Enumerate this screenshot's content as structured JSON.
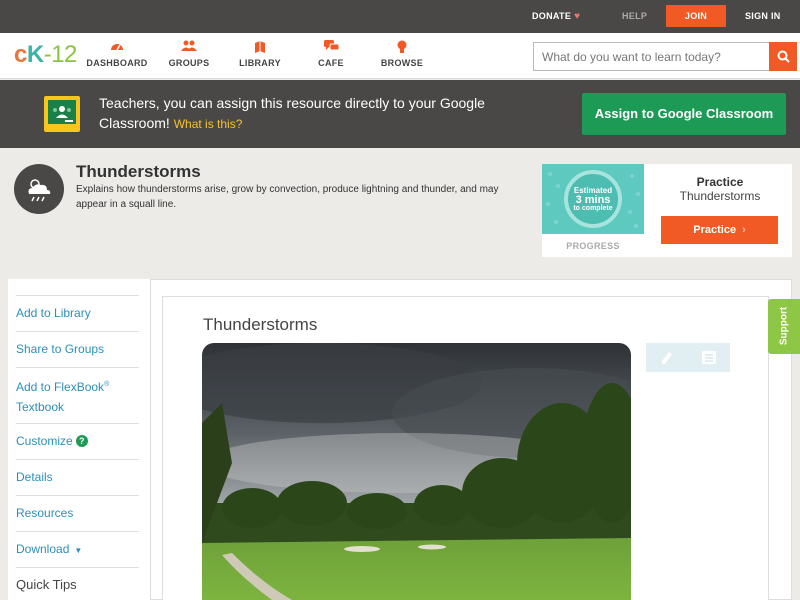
{
  "util": {
    "donate": "DONATE",
    "help": "HELP",
    "join": "JOIN",
    "signin": "SIGN IN"
  },
  "brand": {
    "logo_c": "c",
    "logo_k": "K",
    "logo_dash": "-",
    "logo_num": "12"
  },
  "nav": {
    "dashboard": "DASHBOARD",
    "groups": "GROUPS",
    "library": "LIBRARY",
    "cafe": "CAFE",
    "browse": "BROWSE"
  },
  "search": {
    "placeholder": "What do you want to learn today?"
  },
  "banner": {
    "text": "Teachers, you can assign this resource directly to your Google Classroom!",
    "whatis": "What is this?",
    "button": "Assign to Google Classroom"
  },
  "concept": {
    "title": "Thunderstorms",
    "description": "Explains how thunderstorms arise, grow by convection, produce lightning and thunder, and may appear in a squall line."
  },
  "practice_card": {
    "estimated": "Estimated",
    "mins": "3 mins",
    "to_complete": "to complete",
    "progress_label": "PROGRESS",
    "title": "Practice",
    "subtitle": "Thunderstorms",
    "button": "Practice"
  },
  "sidebar": {
    "items": [
      {
        "label": "Add to Library"
      },
      {
        "label": "Share to Groups"
      },
      {
        "label": "Add to FlexBook",
        "sup": "®",
        "label2": "Textbook"
      },
      {
        "label": "Customize"
      },
      {
        "label": "Details"
      },
      {
        "label": "Resources"
      },
      {
        "label": "Download"
      },
      {
        "label": "Quick Tips"
      }
    ]
  },
  "article": {
    "title": "Thunderstorms"
  },
  "support": {
    "label": "Support"
  },
  "colors": {
    "accent_orange": "#f15a24",
    "google_green": "#1e9a57",
    "link_blue": "#2c8fb8",
    "dark_bar": "#4a4847",
    "support_green": "#8ec646"
  },
  "icons": {
    "heart": "heart-icon",
    "search": "search-icon",
    "weather": "thunderstorm-cloud-icon",
    "pen": "pencil-icon",
    "note": "notes-icon"
  }
}
